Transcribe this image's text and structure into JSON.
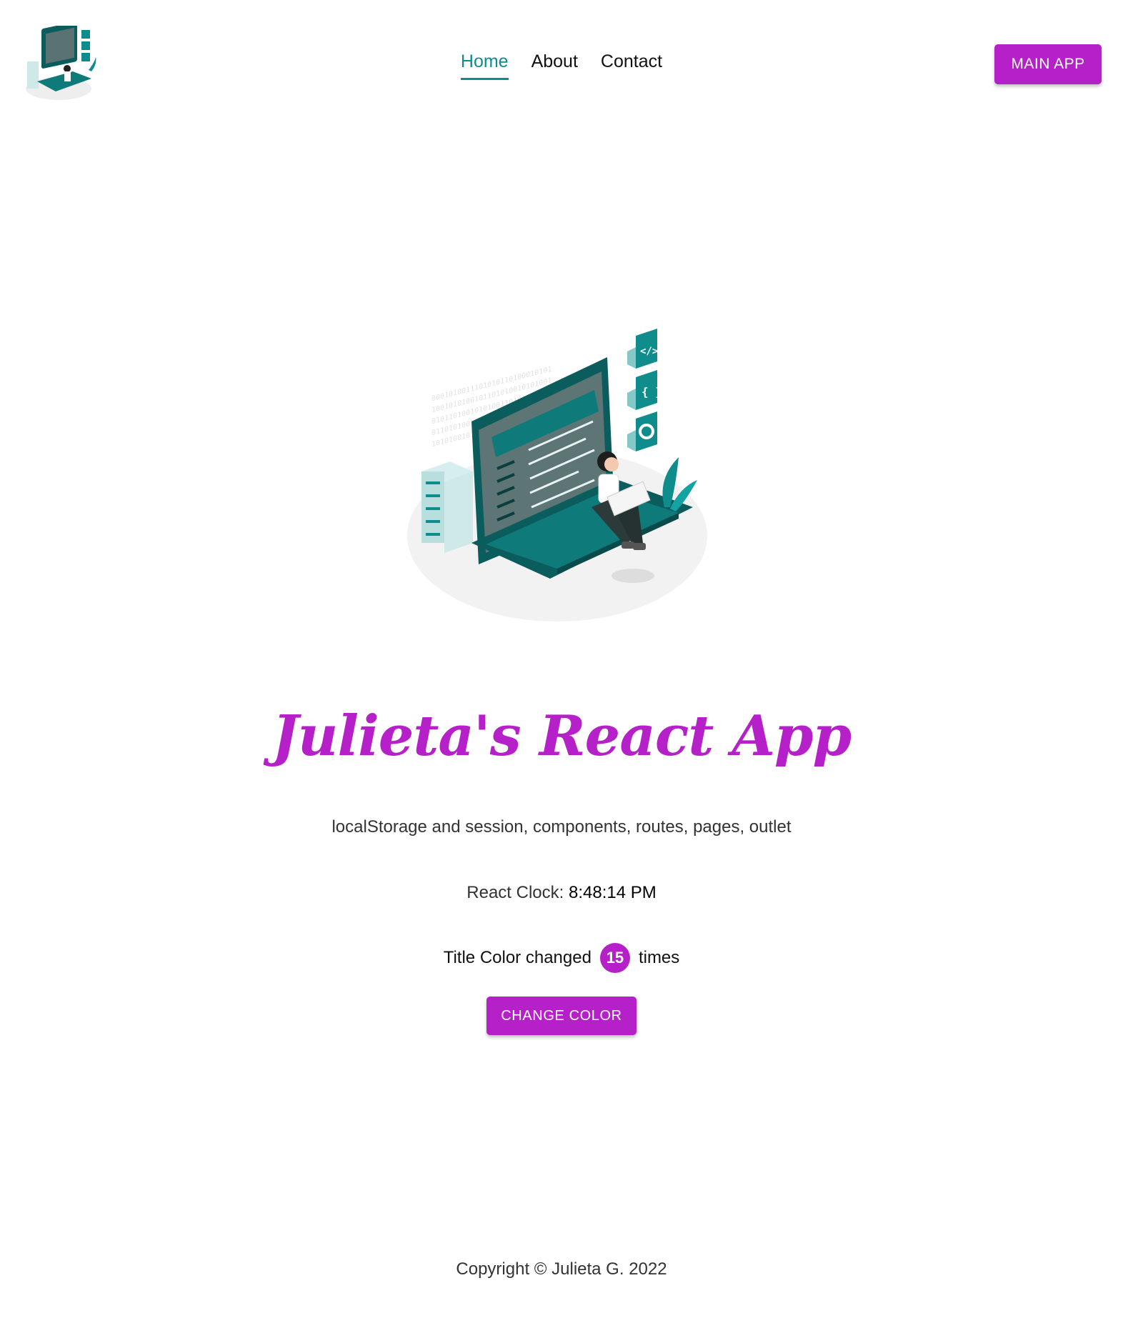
{
  "nav": {
    "items": [
      {
        "label": "Home",
        "active": true
      },
      {
        "label": "About",
        "active": false
      },
      {
        "label": "Contact",
        "active": false
      }
    ]
  },
  "header": {
    "main_app_label": "MAIN APP",
    "logo_icon": "developer-laptop-illustration-icon"
  },
  "hero": {
    "illustration_icon": "developer-laptop-illustration"
  },
  "main": {
    "title": "Julieta's React App",
    "subtitle": "localStorage and session, components, routes, pages, outlet",
    "clock_label": "React Clock:",
    "clock_time": "8:48:14 PM",
    "counter_prefix": "Title Color changed",
    "counter_value": "15",
    "counter_suffix": "times",
    "change_color_label": "CHANGE COLOR"
  },
  "footer": {
    "copyright": "Copyright © Julieta G. 2022"
  },
  "colors": {
    "accent": "#b620c9",
    "teal": "#0f8c8c",
    "dark_teal": "#0b5c5c"
  }
}
